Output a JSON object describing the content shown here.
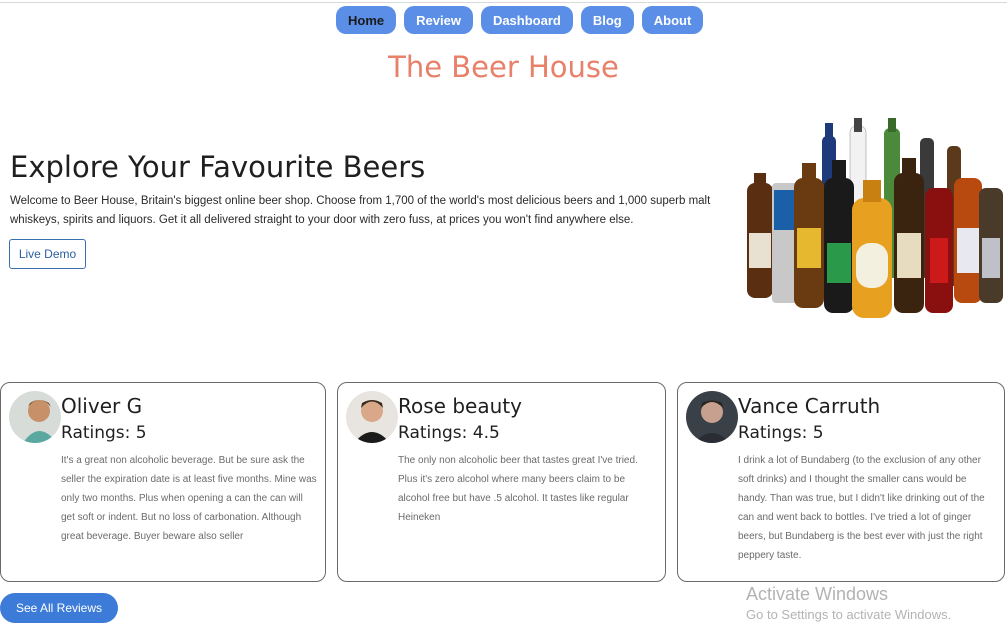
{
  "nav": {
    "items": [
      {
        "label": "Home",
        "active": true
      },
      {
        "label": "Review",
        "active": false
      },
      {
        "label": "Dashboard",
        "active": false
      },
      {
        "label": "Blog",
        "active": false
      },
      {
        "label": "About",
        "active": false
      }
    ]
  },
  "site": {
    "title": "The Beer House"
  },
  "hero": {
    "title": "Explore Your Favourite Beers",
    "text": "Welcome to Beer House, Britain's biggest online beer shop. Choose from 1,700 of the world's most delicious beers and 1,000 superb malt whiskeys, spirits and liquors. Get it all delivered straight to your door with zero fuss, at prices you won't find anywhere else.",
    "button_label": "Live Demo"
  },
  "reviews": [
    {
      "name": "Oliver G",
      "rating": "Ratings: 5",
      "text": "It's a great non alcoholic beverage. But be sure ask the seller the expiration date is at least five months. Mine was only two months. Plus when opening a can the can will get soft or indent. But no loss of carbonation. Although great beverage. Buyer beware also seller"
    },
    {
      "name": "Rose beauty",
      "rating": "Ratings: 4.5",
      "text": "The only non alcoholic beer that tastes great I've tried. Plus it's zero alcohol where many beers claim to be alcohol free but have .5 alcohol. It tastes like regular Heineken"
    },
    {
      "name": "Vance Carruth",
      "rating": "Ratings: 5",
      "text": "I drink a lot of Bundaberg (to the exclusion of any other soft drinks) and I thought the smaller cans would be handy. Than was true, but I didn't like drinking out of the can and went back to bottles. I've tried a lot of ginger beers, but Bundaberg is the best ever with just the right peppery taste."
    }
  ],
  "all_reviews_label": "See All Reviews",
  "watermark": {
    "title": "Activate Windows",
    "subtitle": "Go to Settings to activate Windows."
  },
  "colors": {
    "nav_button": "#5b8ee6",
    "site_title": "#e8806a",
    "primary_button": "#3d7bd8"
  }
}
